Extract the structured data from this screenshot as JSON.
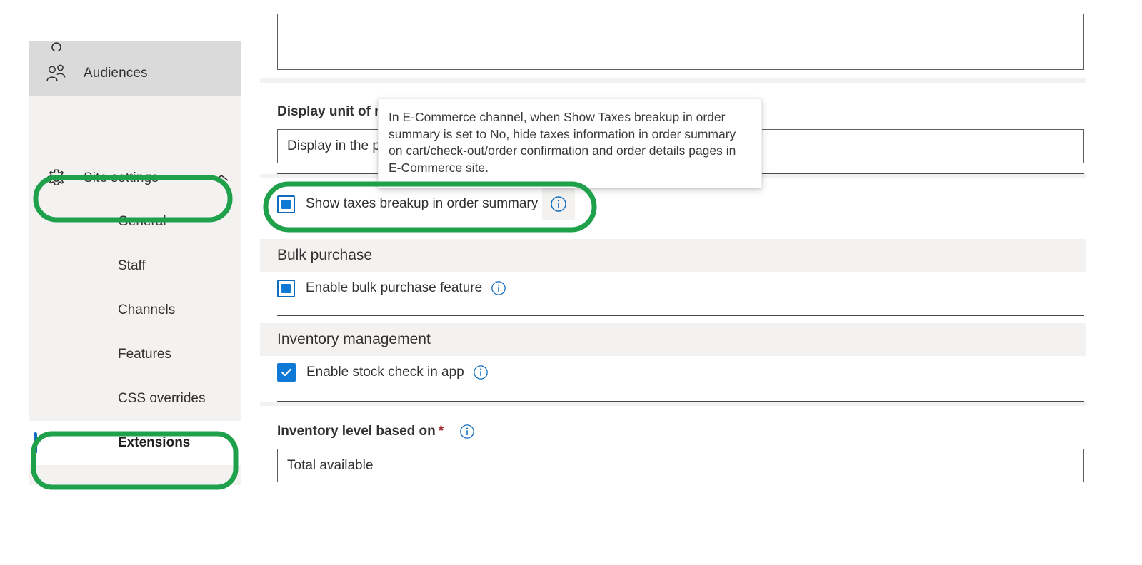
{
  "sidebar": {
    "items": [
      {
        "label": "Audiences",
        "icon": "people-icon",
        "state": "hovered",
        "type": "item"
      },
      {
        "label": "Site settings",
        "icon": "gear-icon",
        "state": "expanded",
        "type": "group"
      },
      {
        "label": "General",
        "type": "sub",
        "state": "normal"
      },
      {
        "label": "Staff",
        "type": "sub",
        "state": "normal"
      },
      {
        "label": "Channels",
        "type": "sub",
        "state": "normal"
      },
      {
        "label": "Features",
        "type": "sub",
        "state": "normal"
      },
      {
        "label": "CSS overrides",
        "type": "sub",
        "state": "normal"
      },
      {
        "label": "Extensions",
        "type": "sub",
        "state": "selected"
      }
    ],
    "chevron_icon": "chevron-up-icon",
    "selected_indicator_color": "#0f6cbd"
  },
  "main": {
    "display_unit_field": {
      "label": "Display unit of measure",
      "value": "Display in the product details"
    },
    "taxes_checkbox": {
      "label": "Show taxes breakup in order summary",
      "state": "mixed",
      "info_icon": "info-icon"
    },
    "bulk_purchase_section": {
      "title": "Bulk purchase",
      "checkbox": {
        "label": "Enable bulk purchase feature",
        "state": "mixed",
        "info_icon": "info-icon"
      }
    },
    "inventory_section": {
      "title": "Inventory management",
      "checkbox": {
        "label": "Enable stock check in app",
        "state": "checked",
        "info_icon": "info-icon"
      },
      "level_field": {
        "label": "Inventory level based on",
        "required_marker": "*",
        "value": "Total available",
        "info_icon": "info-icon"
      }
    }
  },
  "tooltip": {
    "text": "In E-Commerce channel, when Show Taxes breakup in order summary is set to No, hide taxes information in order summary on cart/check-out/order confirmation and order details pages in E-Commerce site."
  },
  "annotations": {
    "color": "#1fa04b",
    "regions": [
      "site-settings-nav-item",
      "extensions-nav-item",
      "show-taxes-breakup-checkbox-row"
    ]
  },
  "colors": {
    "accent_blue": "#0f7ad6",
    "selection_blue": "#0f6cbd",
    "sidebar_bg": "#f3f2f1",
    "hover_gray": "#dadada",
    "required_red": "#a4262c",
    "annotation_green": "#1fa04b"
  }
}
